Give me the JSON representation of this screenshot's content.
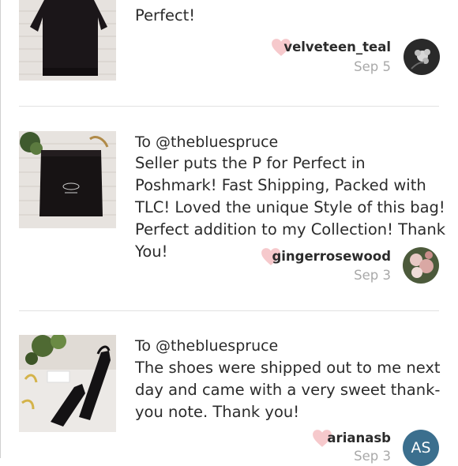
{
  "comments": [
    {
      "message": "Perfect!",
      "username": "velveteen_teal",
      "date": "Sep 5",
      "avatar": "flower-avatar"
    },
    {
      "to": "To @thebluespruce",
      "message": "Seller puts the P for Perfect in Poshmark! Fast Shipping, Packed with TLC! Loved the unique Style of this bag! Perfect addition to my Collection! Thank You!",
      "username": "gingerrosewood",
      "date": "Sep 3",
      "avatar": "roses-avatar"
    },
    {
      "to": "To @thebluespruce",
      "message": "The shoes were shipped out to me next day and came with a very sweet thank-you note. Thank you!",
      "username": "arianasb",
      "date": "Sep 3",
      "avatar_initials": "AS"
    }
  ],
  "colors": {
    "heart": "#f6c9cc",
    "avatar_initials_bg": "#3b6f8e",
    "date": "#a9a9a9"
  }
}
